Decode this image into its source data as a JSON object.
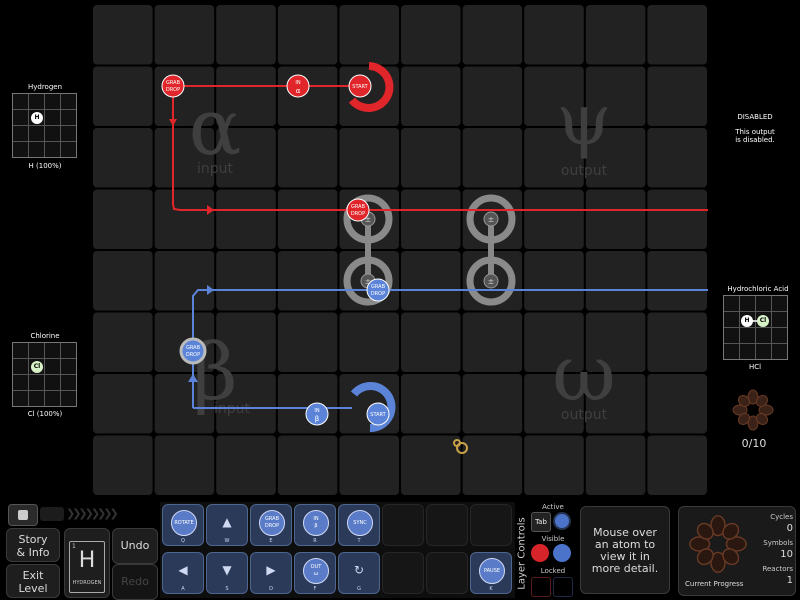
{
  "inputs": {
    "alpha": {
      "molecule": "Hydrogen",
      "atom": "H",
      "footer": "H (100%)"
    },
    "beta": {
      "molecule": "Chlorine",
      "atom": "Cl",
      "footer": "Cl (100%)"
    }
  },
  "outputs": {
    "psi": {
      "status": "DISABLED",
      "message_line1": "This output",
      "message_line2": "is disabled."
    },
    "omega": {
      "molecule": "Hydrochloric Acid",
      "atoms": [
        "H",
        "Cl"
      ],
      "footer": "HCl",
      "progress": "0/10"
    }
  },
  "board": {
    "zones": {
      "alpha_symbol": "α",
      "alpha_label": "input",
      "psi_symbol": "ψ",
      "psi_label": "output",
      "beta_symbol": "β",
      "beta_label": "input",
      "omega_symbol": "ω",
      "omega_label": "output"
    },
    "red_symbols": {
      "start": "START",
      "in_a1": "IN",
      "in_a2": "α",
      "grab": "GRAB",
      "drop": "DROP"
    },
    "blue_symbols": {
      "start": "START",
      "in_b1": "IN",
      "in_b2": "β",
      "grab": "GRAB",
      "drop": "DROP"
    },
    "bond": "±"
  },
  "bottom_left": {
    "story_line1": "Story",
    "story_line2": "& Info",
    "exit_line1": "Exit",
    "exit_line2": "Level",
    "element_symbol": "H",
    "element_name": "HYDROGEN",
    "element_number": "1",
    "undo": "Undo",
    "redo": "Redo"
  },
  "controls": {
    "row1": [
      {
        "l1": "ROTATE",
        "l2": "",
        "key": "Q"
      },
      {
        "l1": "▲",
        "l2": "",
        "key": "W"
      },
      {
        "l1": "GRAB",
        "l2": "DROP",
        "key": "E"
      },
      {
        "l1": "IN",
        "l2": "β",
        "key": "R"
      },
      {
        "l1": "SYNC",
        "l2": "",
        "key": "T"
      }
    ],
    "row2": [
      {
        "l1": "◀",
        "l2": "",
        "key": "A"
      },
      {
        "l1": "▼",
        "l2": "",
        "key": "S"
      },
      {
        "l1": "▶",
        "l2": "",
        "key": "D"
      },
      {
        "l1": "OUT",
        "l2": "ω",
        "key": "F"
      },
      {
        "l1": "↻",
        "l2": "",
        "key": "G"
      }
    ],
    "pause": {
      "l1": "PAUSE",
      "key": "K"
    }
  },
  "layer_controls": {
    "title": "Layer Controls",
    "active": "Active",
    "tab": "Tab",
    "visible": "Visible",
    "locked": "Locked"
  },
  "info_box": {
    "line1": "Mouse over",
    "line2": "an atom to",
    "line3": "view it in",
    "line4": "more detail."
  },
  "stats": {
    "cycles_label": "Cycles",
    "cycles": "0",
    "symbols_label": "Symbols",
    "symbols": "10",
    "reactors_label": "Reactors",
    "reactors": "1",
    "progress_label": "Current Progress"
  },
  "colors": {
    "red": "#e0262a",
    "blue": "#5b84d8",
    "cell": "#222222",
    "cell_border": "#111111"
  }
}
